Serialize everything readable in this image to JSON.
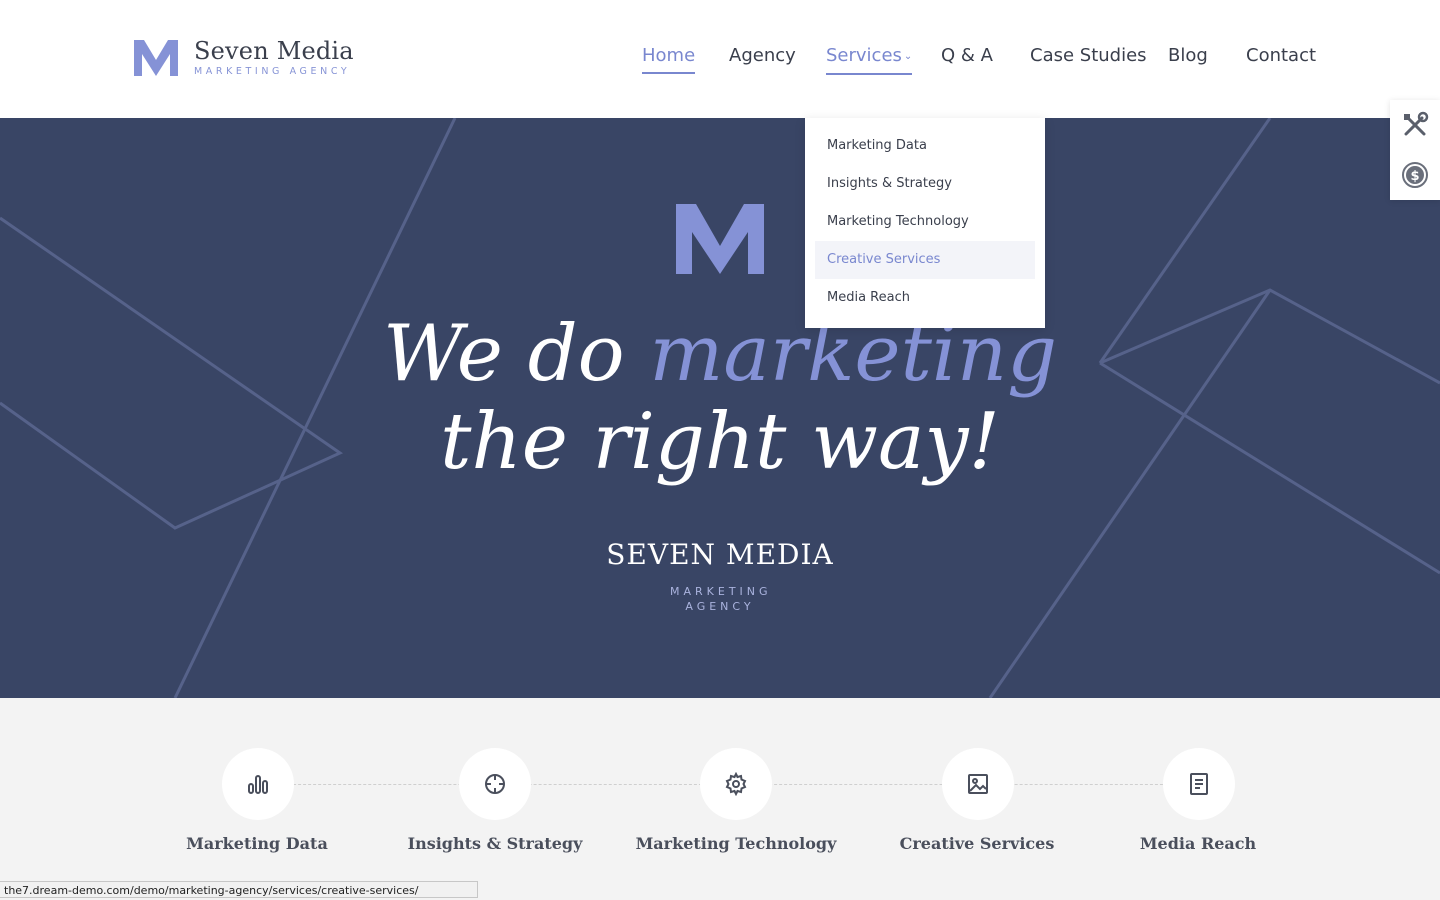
{
  "brand": {
    "name": "Seven Media",
    "tagline": "MARKETING AGENCY"
  },
  "nav": {
    "items": [
      {
        "label": "Home",
        "active": true
      },
      {
        "label": "Agency"
      },
      {
        "label": "Services",
        "has_dropdown": true,
        "open": true
      },
      {
        "label": "Q & A"
      },
      {
        "label": "Case Studies"
      },
      {
        "label": "Blog"
      },
      {
        "label": "Contact"
      }
    ]
  },
  "services_menu": {
    "items": [
      {
        "label": "Marketing Data"
      },
      {
        "label": "Insights & Strategy"
      },
      {
        "label": "Marketing Technology"
      },
      {
        "label": "Creative Services",
        "hovered": true
      },
      {
        "label": "Media Reach"
      }
    ]
  },
  "side_tools": {
    "items": [
      {
        "icon": "tools-icon"
      },
      {
        "icon": "dollar-coin-icon"
      }
    ]
  },
  "hero": {
    "line1_a": "We do",
    "line1_b": "marketing",
    "line2": "the right way!",
    "brand_big": "SEVEN MEDIA",
    "brand_sub": "MARKETING AGENCY"
  },
  "services": {
    "items": [
      {
        "label": "Marketing Data",
        "icon": "bar-chart-icon"
      },
      {
        "label": "Insights & Strategy",
        "icon": "crosshair-icon"
      },
      {
        "label": "Marketing Technology",
        "icon": "gear-icon"
      },
      {
        "label": "Creative Services",
        "icon": "image-icon"
      },
      {
        "label": "Media Reach",
        "icon": "document-icon"
      }
    ]
  },
  "status_bar": {
    "url": "the7.dream-demo.com/demo/marketing-agency/services/creative-services/"
  },
  "colors": {
    "accent": "#7987cf",
    "hero_bg": "#394565",
    "text_dark": "#3a3f4c",
    "strip_bg": "#f3f3f3"
  }
}
